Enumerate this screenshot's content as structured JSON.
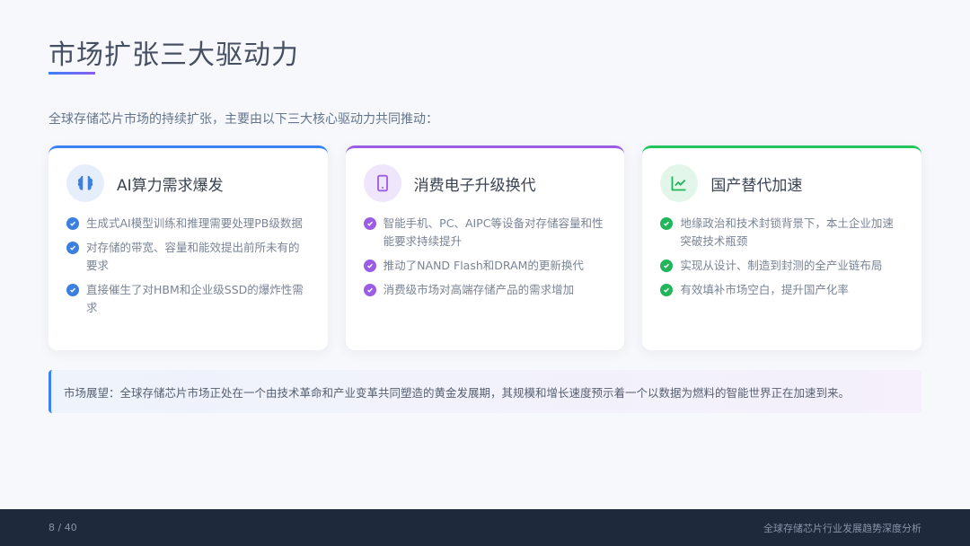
{
  "slide": {
    "title": "市场扩张三大驱动力",
    "intro": "全球存储芯片市场的持续扩张，主要由以下三大核心驱动力共同推动："
  },
  "cards": [
    {
      "title": "AI算力需求爆发",
      "icon": "brain-icon",
      "accent": "#3b82f6",
      "bullets": [
        "生成式AI模型训练和推理需要处理PB级数据",
        "对存储的带宽、容量和能效提出前所未有的要求",
        "直接催生了对HBM和企业级SSD的爆炸性需求"
      ]
    },
    {
      "title": "消费电子升级换代",
      "icon": "smartphone-icon",
      "accent": "#9b5de5",
      "bullets": [
        "智能手机、PC、AIPC等设备对存储容量和性能要求持续提升",
        "推动了NAND Flash和DRAM的更新换代",
        "消费级市场对高端存储产品的需求增加"
      ]
    },
    {
      "title": "国产替代加速",
      "icon": "trend-chart-icon",
      "accent": "#22c55e",
      "bullets": [
        "地缘政治和技术封锁背景下，本土企业加速突破技术瓶颈",
        "实现从设计、制造到封测的全产业链布局",
        "有效填补市场空白，提升国产化率"
      ]
    }
  ],
  "outlook": {
    "text": "市场展望：全球存储芯片市场正处在一个由技术革命和产业变革共同塑造的黄金发展期，其规模和增长速度预示着一个以数据为燃料的智能世界正在加速到来。"
  },
  "footer": {
    "current_page": "8",
    "page_sep": " / ",
    "total_pages": "40",
    "doc_title": "全球存储芯片行业发展趋势深度分析"
  }
}
